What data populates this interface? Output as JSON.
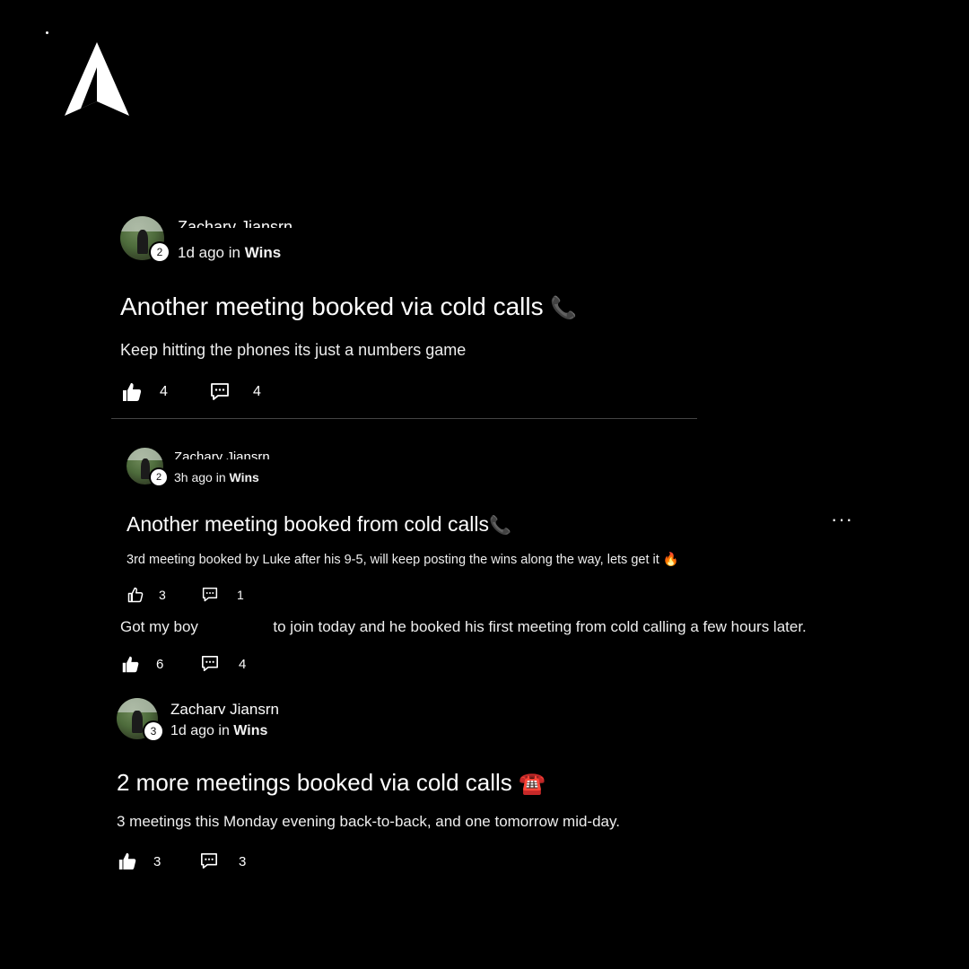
{
  "posts": [
    {
      "author": "Zachary Jiansrn",
      "level": "2",
      "time": "1d ago",
      "in_label": "in",
      "category": "Wins",
      "title": "Another meeting booked via cold calls",
      "title_emoji": "📞",
      "body": "Keep hitting the phones its just a numbers game",
      "likes": "4",
      "comments": "4"
    },
    {
      "author": "Zachary Jiansrn",
      "level": "2",
      "time": "3h ago",
      "in_label": "in",
      "category": "Wins",
      "title": "Another meeting booked from cold calls",
      "title_emoji": "📞",
      "body": "3rd meeting booked by Luke after his 9-5, will keep posting the wins along the way, lets get it",
      "body_emoji": "🔥",
      "likes": "3",
      "comments": "1",
      "more_label": "···"
    },
    {
      "body_prefix": "Got my boy",
      "body_suffix": "to join today and he booked his first meeting from cold calling a few hours later.",
      "likes": "6",
      "comments": "4"
    },
    {
      "author": "Zachary Jiansrn",
      "level": "3",
      "time": "1d ago",
      "in_label": "in",
      "category": "Wins",
      "title": "2 more meetings booked via cold calls",
      "title_emoji": "☎️",
      "body": "3 meetings this Monday evening back-to-back, and one tomorrow mid-day.",
      "likes": "3",
      "comments": "3"
    }
  ]
}
